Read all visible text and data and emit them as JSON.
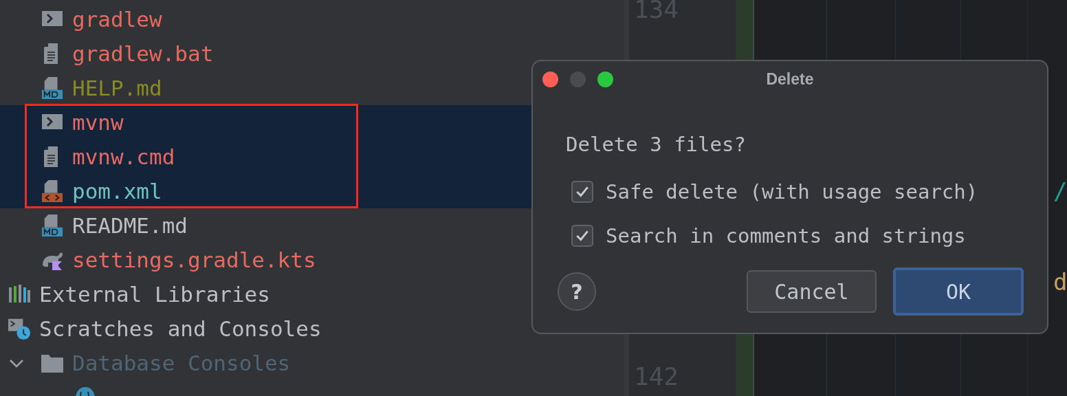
{
  "project_files": [
    {
      "name": "gradlew",
      "kind": "script",
      "color": "#e8695f",
      "selected": false
    },
    {
      "name": "gradlew.bat",
      "kind": "text",
      "color": "#e8695f",
      "selected": false
    },
    {
      "name": "HELP.md",
      "kind": "markdown",
      "color": "#8a8a25",
      "selected": false
    },
    {
      "name": "mvnw",
      "kind": "script",
      "color": "#e8695f",
      "selected": true
    },
    {
      "name": "mvnw.cmd",
      "kind": "text",
      "color": "#e8695f",
      "selected": true
    },
    {
      "name": "pom.xml",
      "kind": "xml",
      "color": "#6cc4bd",
      "selected": true
    },
    {
      "name": "README.md",
      "kind": "markdown",
      "color": "#bcbec4",
      "selected": false
    },
    {
      "name": "settings.gradle.kts",
      "kind": "gradle",
      "color": "#e8695f",
      "selected": false
    }
  ],
  "tree": [
    {
      "name": "External Libraries",
      "kind": "libraries"
    },
    {
      "name": "Scratches and Consoles",
      "kind": "scratches",
      "children": [
        {
          "name": "Database Consoles",
          "kind": "folder",
          "expanded": true,
          "color": "#4d6576",
          "children": [
            {
              "kind": "postgres"
            }
          ]
        }
      ]
    }
  ],
  "editor": {
    "top_line_numbers": [
      "134"
    ],
    "code_fragments": [
      {
        "code": "/",
        "color": "#1f9c8c"
      },
      {
        "code": "d",
        "color": "#c8a25e"
      }
    ],
    "bottom_line_numbers": [
      "142"
    ]
  },
  "dialog": {
    "title": "Delete",
    "message": "Delete 3 files?",
    "options": [
      {
        "label": "Safe delete (with usage search)",
        "checked": true
      },
      {
        "label": "Search in comments and strings",
        "checked": true
      }
    ],
    "help": "?",
    "buttons": [
      {
        "label": "Cancel",
        "default": false
      },
      {
        "label": "OK",
        "default": true
      }
    ]
  }
}
